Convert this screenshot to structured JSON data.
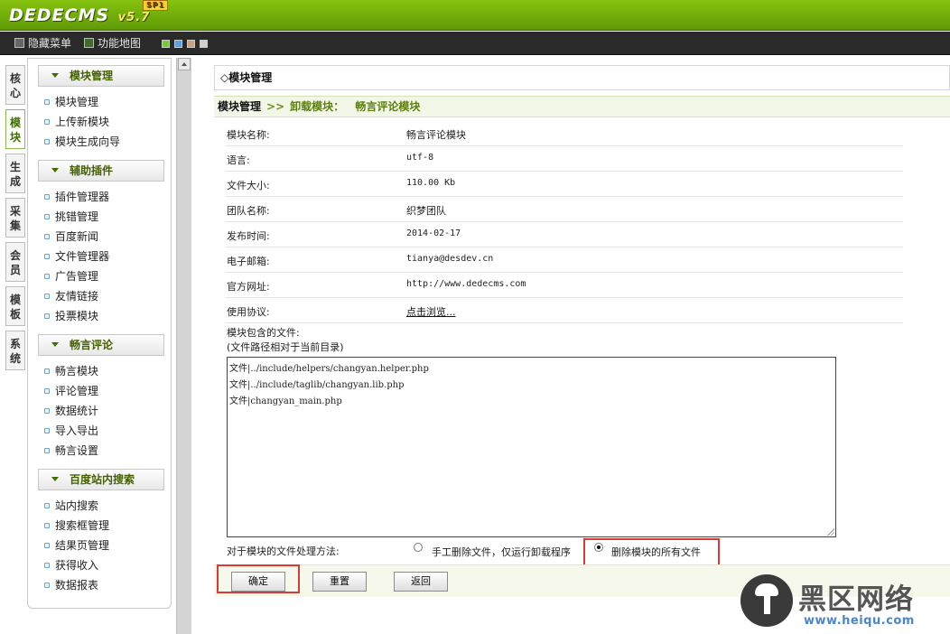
{
  "app": {
    "logo": "DEDECMS",
    "version": "v5.7",
    "edition": "SP1"
  },
  "menubar": {
    "hide_menu": "隐藏菜单",
    "site_map": "功能地图"
  },
  "vtabs": [
    {
      "label": "核心",
      "active": false
    },
    {
      "label": "模块",
      "active": true
    },
    {
      "label": "生成",
      "active": false
    },
    {
      "label": "采集",
      "active": false
    },
    {
      "label": "会员",
      "active": false
    },
    {
      "label": "模板",
      "active": false
    },
    {
      "label": "系统",
      "active": false
    }
  ],
  "sidebar": {
    "groups": [
      {
        "title": "模块管理",
        "items": [
          "模块管理",
          "上传新模块",
          "模块生成向导"
        ]
      },
      {
        "title": "辅助插件",
        "items": [
          "插件管理器",
          "挑错管理",
          "百度新闻",
          "文件管理器",
          "广告管理",
          "友情链接",
          "投票模块"
        ]
      },
      {
        "title": "畅言评论",
        "items": [
          "畅言模块",
          "评论管理",
          "数据统计",
          "导入导出",
          "畅言设置"
        ]
      },
      {
        "title": "百度站内搜索",
        "items": [
          "站内搜索",
          "搜索框管理",
          "结果页管理",
          "获得收入",
          "数据报表"
        ]
      }
    ]
  },
  "main": {
    "title": "◇模块管理",
    "breadcrumb": {
      "root": "模块管理",
      "sep": ">>",
      "step": "卸载模块：",
      "current": "畅言评论模块"
    },
    "rows": [
      {
        "label": "模块名称:",
        "value": "畅言评论模块"
      },
      {
        "label": "语言:",
        "value": "utf-8"
      },
      {
        "label": "文件大小:",
        "value": "110.00 Kb"
      },
      {
        "label": "团队名称:",
        "value": "织梦团队"
      },
      {
        "label": "发布时间:",
        "value": "2014-02-17"
      },
      {
        "label": "电子邮箱:",
        "value": "tianya@desdev.cn"
      },
      {
        "label": "官方网址:",
        "value": "http://www.dedecms.com"
      },
      {
        "label": "使用协议:",
        "value": "点击浏览..."
      }
    ],
    "files_label_1": "模块包含的文件:",
    "files_label_2": "(文件路径相对于当前目录)",
    "files": [
      "文件|../include/helpers/changyan.helper.php",
      "文件|../include/taglib/changyan.lib.php",
      "文件|changyan_main.php"
    ],
    "method_label": "对于模块的文件处理方法:",
    "option_manual": "手工删除文件，仅运行卸载程序",
    "option_delete_all": "删除模块的所有文件",
    "selected_option": "delete_all",
    "buttons": {
      "ok": "确定",
      "reset": "重置",
      "back": "返回"
    }
  },
  "watermark": {
    "title": "黑区网络",
    "url": "www.heiqu.com"
  },
  "colors": {
    "topbar": "#6faf0a",
    "menubar": "#2a2a2a",
    "accent_green": "#5c7f0f",
    "highlight_red": "#d93a35"
  }
}
